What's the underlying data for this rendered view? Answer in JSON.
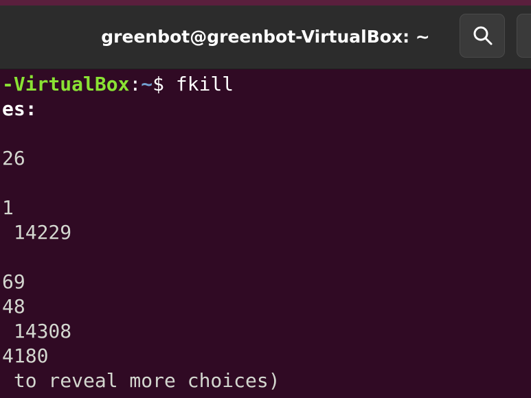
{
  "window": {
    "title": "greenbot@greenbot-VirtualBox: ~",
    "search_icon": "search-icon"
  },
  "terminal": {
    "prompt_host": "-VirtualBox",
    "prompt_sep": ":",
    "prompt_path": "~",
    "prompt_symbol": "$ ",
    "command": "fkill",
    "lines": [
      "es:",
      "",
      "26",
      "",
      "1",
      " 14229",
      "",
      "69",
      "48",
      " 14308",
      "4180",
      " to reveal more choices)"
    ]
  },
  "colors": {
    "background": "#300a24",
    "prompt_user": "#8ae234",
    "prompt_path": "#729fcf",
    "text": "#d3d7cf"
  }
}
